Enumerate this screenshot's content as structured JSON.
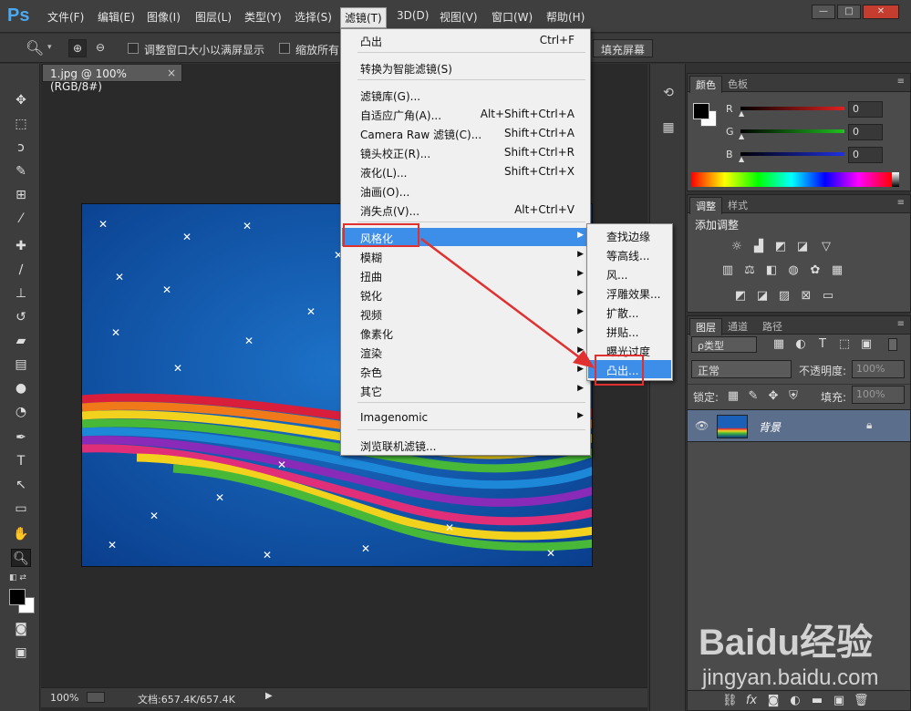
{
  "app": {
    "logo": "Ps"
  },
  "menubar": {
    "items": [
      "文件(F)",
      "编辑(E)",
      "图像(I)",
      "图层(L)",
      "类型(Y)",
      "选择(S)",
      "滤镜(T)",
      "3D(D)",
      "视图(V)",
      "窗口(W)",
      "帮助(H)"
    ],
    "active_index": 6
  },
  "window_controls": {
    "minimize": "—",
    "maximize": "□",
    "close": "✕"
  },
  "options_bar": {
    "resize_windows": "调整窗口大小以满屏显示",
    "zoom_all": "缩放所有",
    "fill_screen": "填充屏幕"
  },
  "document": {
    "tab_title": "1.jpg @ 100%(RGB/8#)",
    "tab_close": "×"
  },
  "status_bar": {
    "zoom": "100%",
    "doc_info": "文档:657.4K/657.4K"
  },
  "filter_menu": {
    "items": [
      {
        "label": "凸出",
        "shortcut": "Ctrl+F"
      },
      {
        "label": "转换为智能滤镜(S)",
        "shortcut": ""
      },
      {
        "label": "滤镜库(G)...",
        "shortcut": ""
      },
      {
        "label": "自适应广角(A)...",
        "shortcut": "Alt+Shift+Ctrl+A"
      },
      {
        "label": "Camera Raw 滤镜(C)...",
        "shortcut": "Shift+Ctrl+A"
      },
      {
        "label": "镜头校正(R)...",
        "shortcut": "Shift+Ctrl+R"
      },
      {
        "label": "液化(L)...",
        "shortcut": "Shift+Ctrl+X"
      },
      {
        "label": "油画(O)...",
        "shortcut": ""
      },
      {
        "label": "消失点(V)...",
        "shortcut": "Alt+Ctrl+V"
      },
      {
        "label": "风格化",
        "shortcut": ""
      },
      {
        "label": "模糊",
        "shortcut": ""
      },
      {
        "label": "扭曲",
        "shortcut": ""
      },
      {
        "label": "锐化",
        "shortcut": ""
      },
      {
        "label": "视频",
        "shortcut": ""
      },
      {
        "label": "像素化",
        "shortcut": ""
      },
      {
        "label": "渲染",
        "shortcut": ""
      },
      {
        "label": "杂色",
        "shortcut": ""
      },
      {
        "label": "其它",
        "shortcut": ""
      },
      {
        "label": "Imagenomic",
        "shortcut": ""
      },
      {
        "label": "浏览联机滤镜...",
        "shortcut": ""
      }
    ]
  },
  "stylize_submenu": {
    "items": [
      "查找边缘",
      "等高线...",
      "风...",
      "浮雕效果...",
      "扩散...",
      "拼贴...",
      "曝光过度",
      "凸出..."
    ],
    "highlighted_index": 7
  },
  "color_panel": {
    "tabs": [
      "颜色",
      "色板"
    ],
    "channels": [
      {
        "label": "R",
        "value": "0",
        "color": "#e02020"
      },
      {
        "label": "G",
        "value": "0",
        "color": "#20c020"
      },
      {
        "label": "B",
        "value": "0",
        "color": "#2030e0"
      }
    ]
  },
  "adjust_panel": {
    "tabs": [
      "调整",
      "样式"
    ],
    "title": "添加调整"
  },
  "layers_panel": {
    "tabs": [
      "图层",
      "通道",
      "路径"
    ],
    "filter_kind": "ρ类型",
    "blend_mode": "正常",
    "opacity_label": "不透明度:",
    "opacity_value": "100%",
    "lock_label": "锁定:",
    "fill_label": "填充:",
    "fill_value": "100%",
    "layers": [
      {
        "name": "背景"
      }
    ]
  },
  "watermark": {
    "brand": "Baidu经验",
    "url": "jingyan.baidu.com"
  }
}
